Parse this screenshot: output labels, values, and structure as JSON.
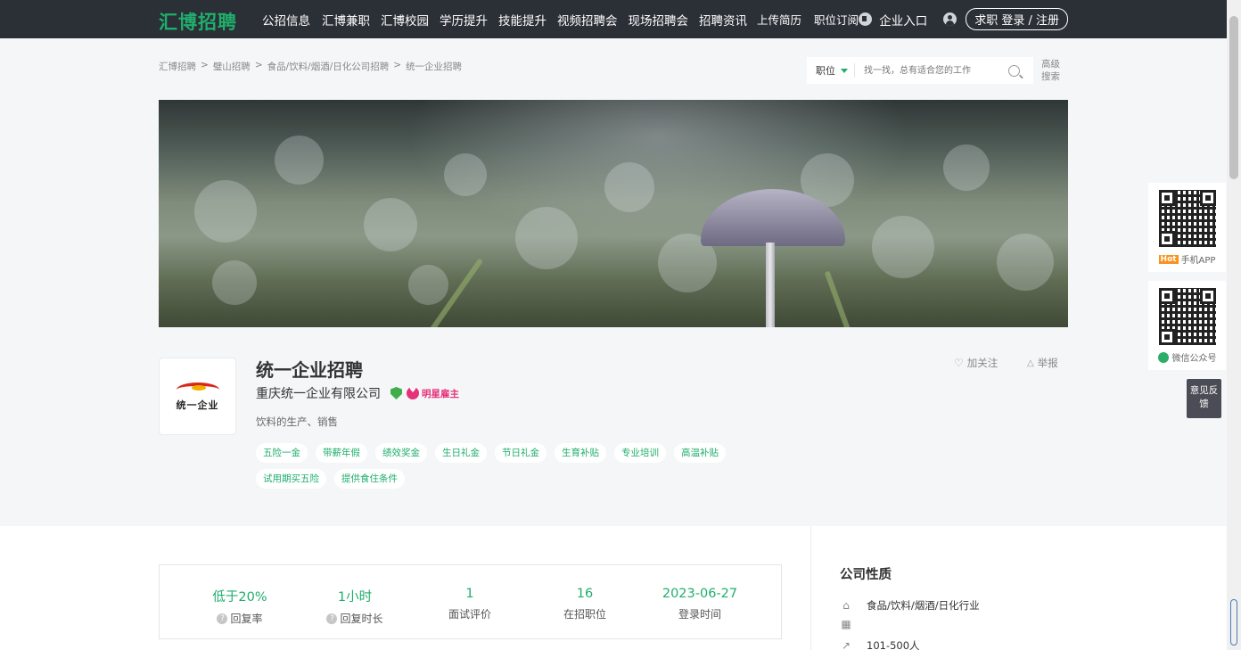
{
  "topnav": {
    "logo": "汇博招聘",
    "links": [
      "公招信息",
      "汇博兼职",
      "汇博校园",
      "学历提升",
      "技能提升",
      "视频招聘会",
      "现场招聘会",
      "招聘资讯",
      "上传简历",
      "职位订阅"
    ],
    "enterprise": "企业入口",
    "login": "求职 登录 / 注册"
  },
  "breadcrumb": [
    "汇博招聘",
    "璧山招聘",
    "食品/饮料/烟酒/日化公司招聘",
    "统一企业招聘"
  ],
  "search": {
    "type_label": "职位",
    "placeholder": "找一找，总有适合您的工作",
    "advanced": "高级搜索"
  },
  "company": {
    "logo_text": "统一企业",
    "title": "统一企业招聘",
    "full_name": "重庆统一企业有限公司",
    "badge": "明星雇主",
    "description": "饮料的生产、销售",
    "follow": "加关注",
    "report": "举报",
    "tags": [
      "五险一金",
      "带薪年假",
      "绩效奖金",
      "生日礼金",
      "节日礼金",
      "生育补贴",
      "专业培训",
      "高温补贴",
      "试用期买五险",
      "提供食住条件"
    ]
  },
  "stats": [
    {
      "value": "低于20%",
      "label": "回复率",
      "help": true
    },
    {
      "value": "1小时",
      "label": "回复时长",
      "help": true
    },
    {
      "value": "1",
      "label": "面试评价",
      "help": false
    },
    {
      "value": "16",
      "label": "在招职位",
      "help": false
    },
    {
      "value": "2023-06-27",
      "label": "登录时间",
      "help": false
    }
  ],
  "sidebar": {
    "title": "公司性质",
    "industry": "食品/饮料/烟酒/日化行业",
    "type": "",
    "size": "101-500人"
  },
  "float": {
    "app_hot": "Hot",
    "app_label": "手机APP",
    "wechat_label": "微信公众号",
    "feedback": "意见反馈"
  },
  "colors": {
    "accent": "#1fae6c",
    "nav_bg": "#2b2f36",
    "badge_pink": "#e5327b"
  }
}
